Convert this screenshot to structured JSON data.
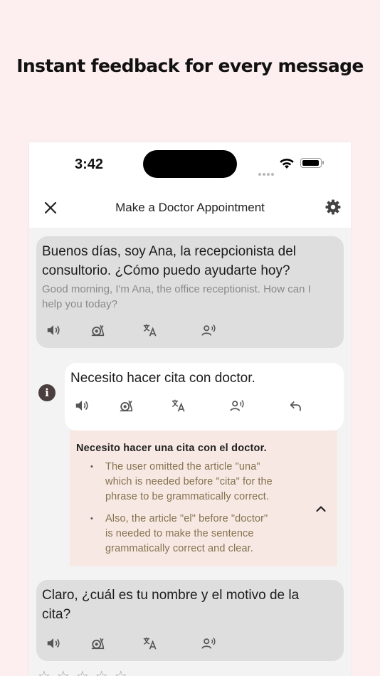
{
  "headline": "Instant feedback for every message",
  "status_bar": {
    "time": "3:42"
  },
  "app_bar": {
    "title": "Make a Doctor Appointment"
  },
  "messages": [
    {
      "role": "assistant",
      "text": "Buenos días, soy Ana, la recepcionista del consultorio. ¿Cómo puedo ayudarte hoy?",
      "text_lines": [
        "Buenos días, soy Ana, la recepcionista del",
        "consultorio. ¿Cómo puedo ayudarte hoy?"
      ],
      "translation": "Good morning, I'm Ana, the office receptionist. How can I help you today?",
      "translation_lines": [
        "Good morning, I'm Ana, the office receptionist. How can I",
        "help you today?"
      ],
      "actions": [
        "speaker-icon",
        "slow-speech-icon",
        "translate-icon",
        "voice-practice-icon"
      ]
    },
    {
      "role": "user",
      "text": "Necesito hacer cita con doctor.",
      "actions": [
        "speaker-icon",
        "slow-speech-icon",
        "translate-icon",
        "voice-practice-icon",
        "undo-icon"
      ],
      "feedback": {
        "correction": "Necesito hacer una cita con el doctor.",
        "points": [
          "The user omitted the article \"una\" which is needed before \"cita\" for the phrase to be grammatically correct.",
          "Also, the article \"el\" before \"doctor\" is needed to make the sentence grammatically correct and clear."
        ],
        "point_lines": [
          [
            "The user omitted the article \"una\"",
            "which is needed before \"cita\" for the",
            "phrase to be grammatically correct."
          ],
          [
            "Also, the article \"el\" before \"doctor\"",
            "is needed to make the sentence",
            "grammatically correct and clear."
          ]
        ]
      }
    },
    {
      "role": "assistant",
      "text": "Claro, ¿cuál es tu nombre y el motivo de la cita?",
      "text_lines": [
        "Claro, ¿cuál es tu nombre y el motivo de la",
        "cita?"
      ],
      "actions": [
        "speaker-icon",
        "slow-speech-icon",
        "translate-icon",
        "voice-practice-icon"
      ]
    }
  ],
  "rating": {
    "stars": "☆☆☆☆☆",
    "value": 0,
    "max": 5
  },
  "colors": {
    "background": "#fdeef0",
    "feedback_bg": "#f7e8e3",
    "feedback_text": "#84724f",
    "bubble_gray": "#dedede"
  }
}
